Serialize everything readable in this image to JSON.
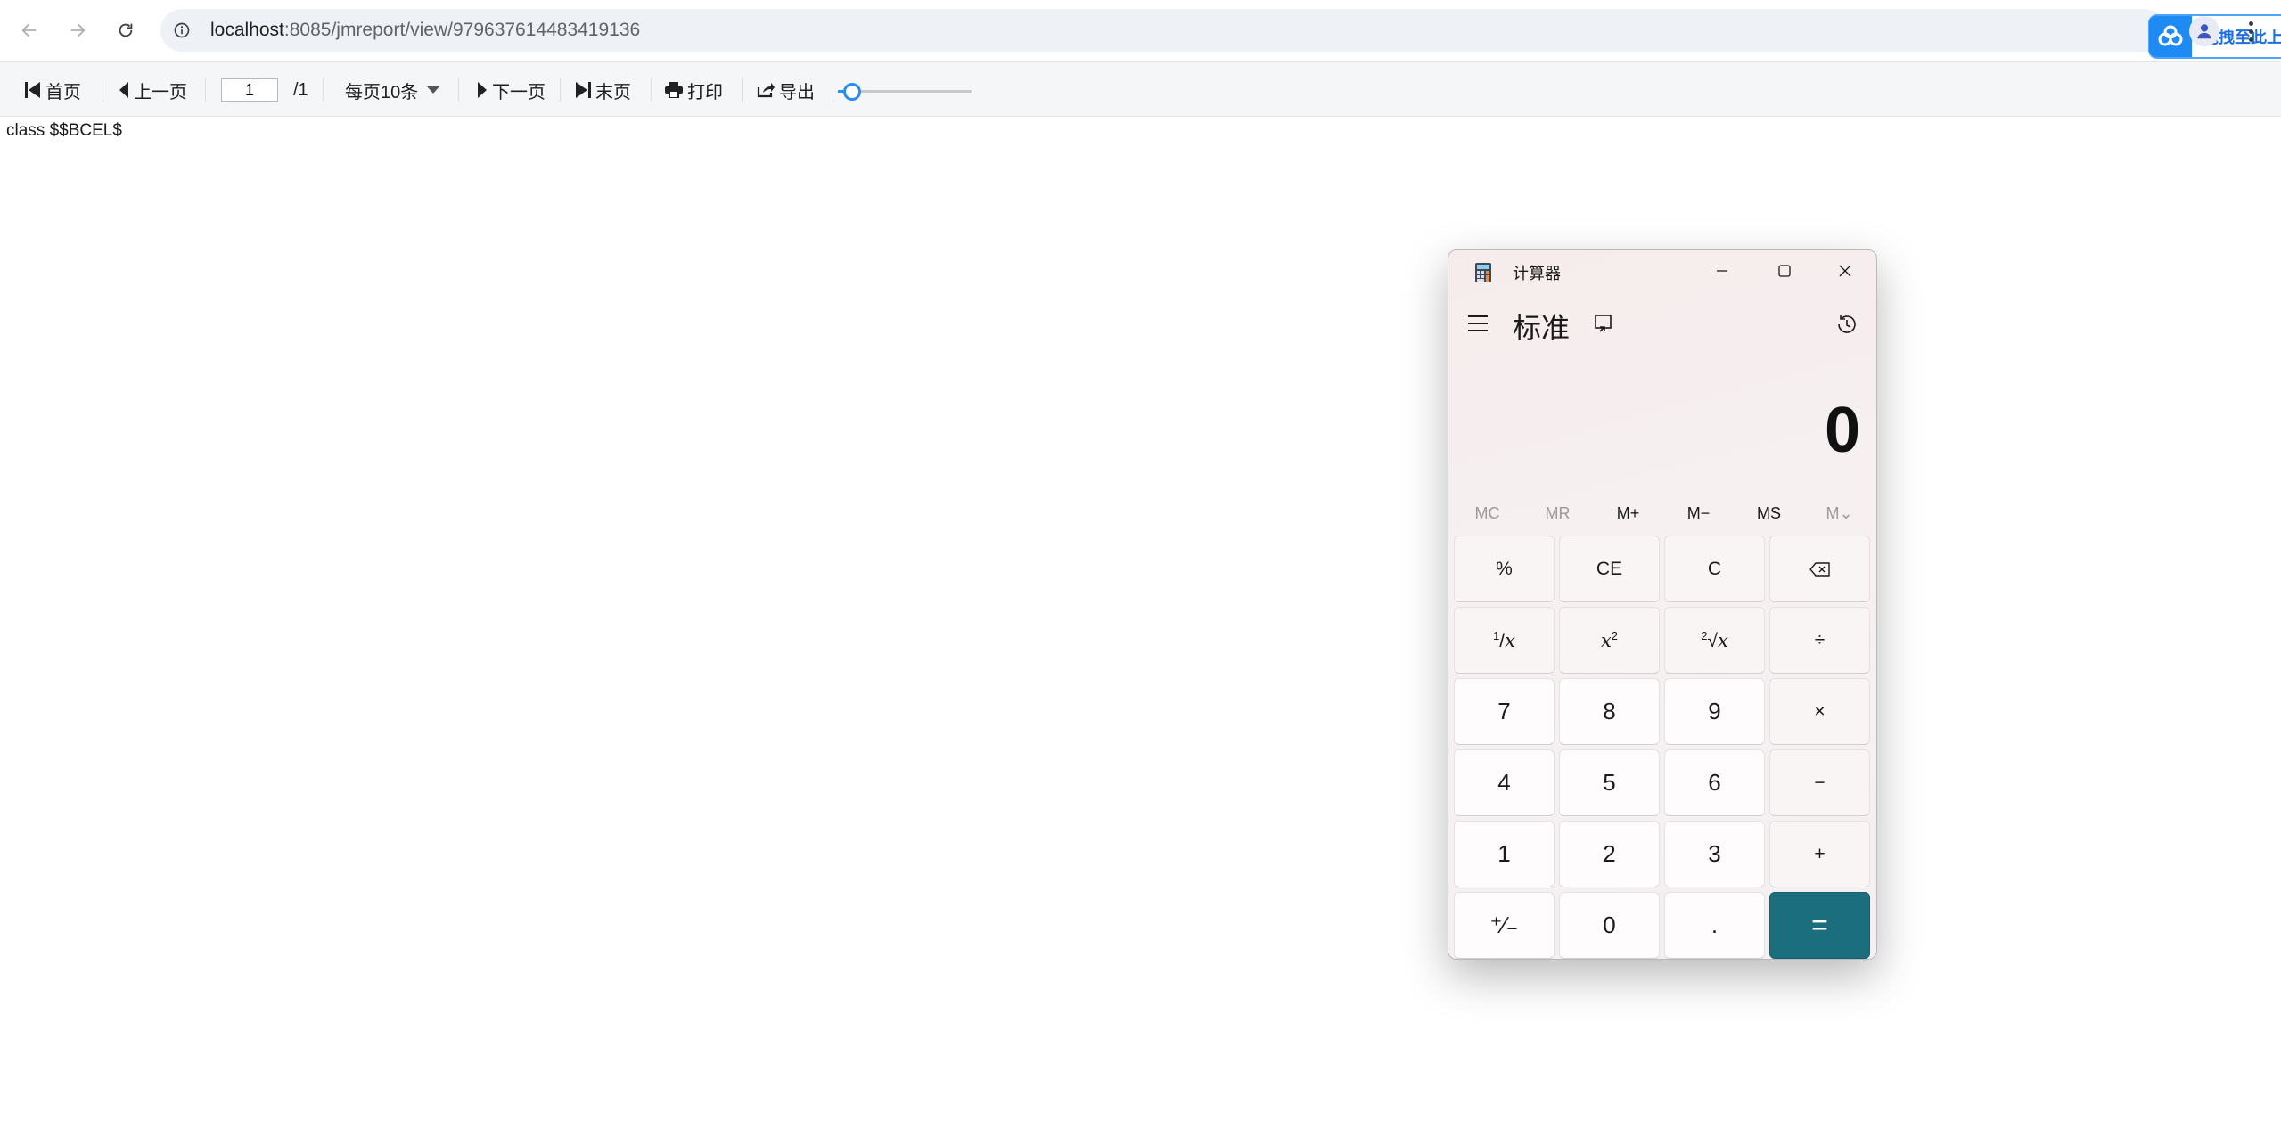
{
  "browser": {
    "url_host": "localhost",
    "url_path": ":8085/jmreport/view/979637614483419136",
    "extension_label": "拖拽至此上传"
  },
  "toolbar": {
    "first_label": "首页",
    "prev_label": "上一页",
    "page_value": "1",
    "page_total": "/1",
    "page_size_label": "每页10条",
    "next_label": "下一页",
    "last_label": "末页",
    "print_label": "打印",
    "export_label": "导出",
    "zoom_fraction": 0.05
  },
  "report": {
    "body_text": "class $$BCEL$"
  },
  "calculator": {
    "window_title": "计算器",
    "mode_title": "标准",
    "display": "0",
    "memory": [
      "MC",
      "MR",
      "M+",
      "M−",
      "MS",
      "M⌄"
    ],
    "keys": {
      "percent": "%",
      "ce": "CE",
      "c": "C",
      "divide": "÷",
      "seven": "7",
      "eight": "8",
      "nine": "9",
      "multiply": "×",
      "four": "4",
      "five": "5",
      "six": "6",
      "minus": "−",
      "one": "1",
      "two": "2",
      "three": "3",
      "plus": "+",
      "negate": "⁺∕₋",
      "zero": "0",
      "dot": ".",
      "equals": "="
    }
  }
}
